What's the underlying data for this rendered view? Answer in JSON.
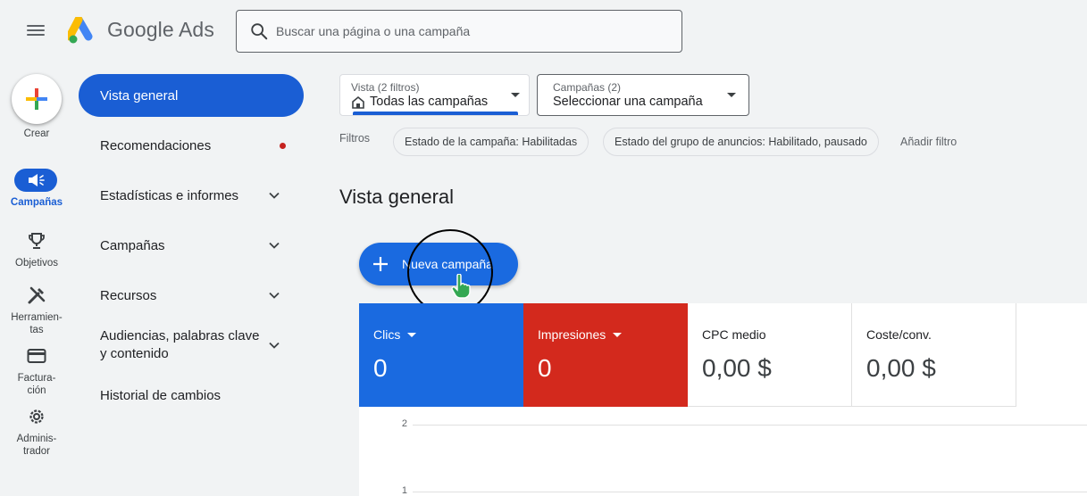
{
  "header": {
    "brand": "Google Ads",
    "search_placeholder": "Buscar una página o una campaña"
  },
  "rail": {
    "create_label": "Crear",
    "campaigns_label": "Campañas",
    "goals_label": "Objetivos",
    "tools_label": "Herramien-\ntas",
    "billing_label": "Factura-\nción",
    "admin_label": "Adminis-\ntrador"
  },
  "nav": {
    "items": [
      {
        "label": "Vista general"
      },
      {
        "label": "Recomendaciones"
      },
      {
        "label": "Estadísticas e informes"
      },
      {
        "label": "Campañas"
      },
      {
        "label": "Recursos"
      },
      {
        "label": "Audiencias, palabras clave y contenido"
      },
      {
        "label": "Historial de cambios"
      }
    ]
  },
  "view_selector": {
    "small": "Vista (2 filtros)",
    "value": "Todas las campañas"
  },
  "campaign_selector": {
    "small": "Campañas (2)",
    "value": "Seleccionar una campaña"
  },
  "filters": {
    "label": "Filtros",
    "chips": [
      "Estado de la campaña: Habilitadas",
      "Estado del grupo de anuncios: Habilitado, pausado"
    ],
    "add_label": "Añadir filtro"
  },
  "main": {
    "title": "Vista general",
    "new_campaign_label": "Nueva campaña"
  },
  "metrics": [
    {
      "label": "Clics",
      "value": "0",
      "color": "#1a6ae0"
    },
    {
      "label": "Impresiones",
      "value": "0",
      "color": "#d3291d"
    },
    {
      "label": "CPC medio",
      "value": "0,00 $"
    },
    {
      "label": "Coste/conv.",
      "value": "0,00 $"
    }
  ],
  "chart": {
    "y_ticks": [
      "2",
      "1"
    ]
  }
}
